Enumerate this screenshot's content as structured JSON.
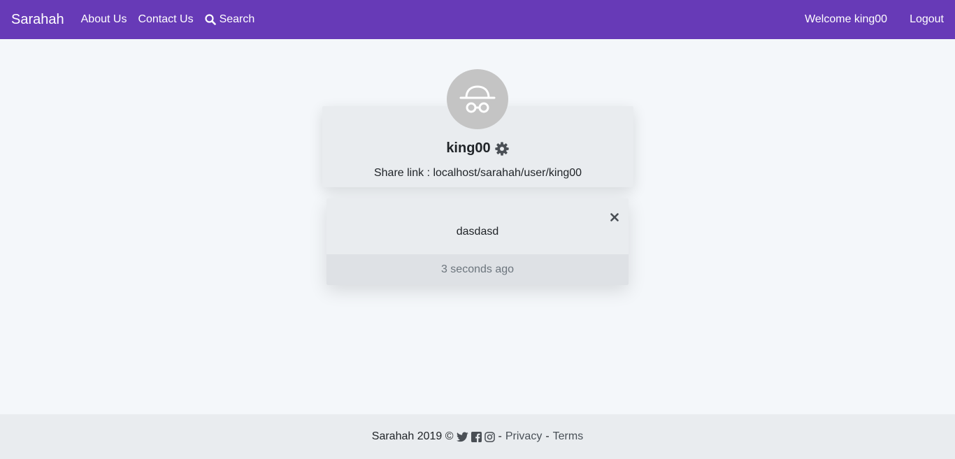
{
  "nav": {
    "brand": "Sarahah",
    "links": {
      "about": "About Us",
      "contact": "Contact Us",
      "search": "Search"
    },
    "welcome": "Welcome king00",
    "logout": "Logout"
  },
  "profile": {
    "avatar_icon": "incognito-icon",
    "username": "king00",
    "settings_icon": "gear-icon",
    "share_link": "Share link : localhost/sarahah/user/king00"
  },
  "messages": [
    {
      "text": "dasdasd",
      "time": "3 seconds ago",
      "close_icon": "close-icon"
    }
  ],
  "footer": {
    "copyright": "Sarahah 2019 ©",
    "social_icons": [
      "twitter-icon",
      "facebook-icon",
      "instagram-icon"
    ],
    "sep1": "-",
    "privacy": "Privacy",
    "sep2": "-",
    "terms": "Terms"
  },
  "colors": {
    "navbar": "#673ab7",
    "page_bg": "#f4f7fa",
    "card_bg": "#e9ecef",
    "avatar_bg": "#c4c4c4"
  }
}
